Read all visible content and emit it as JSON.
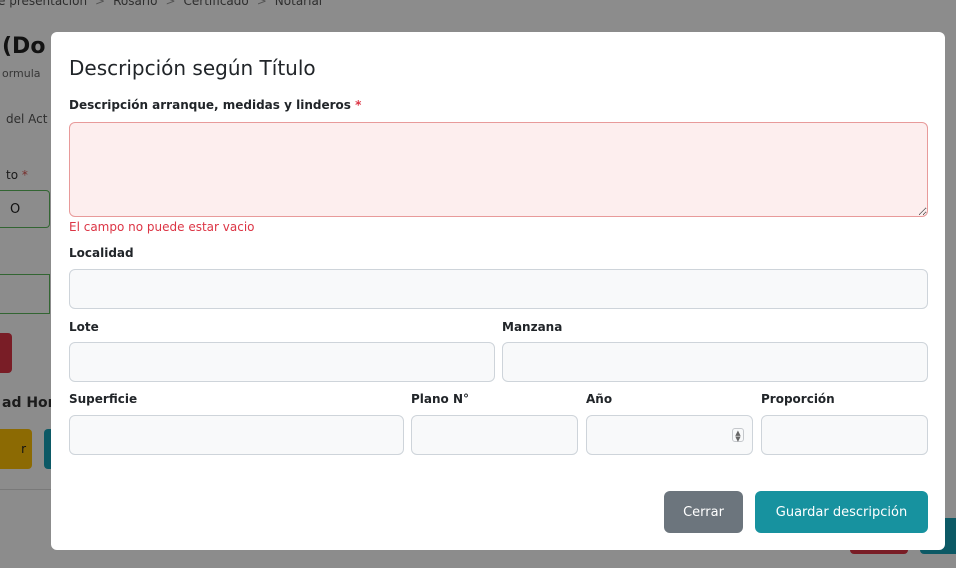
{
  "background": {
    "breadcrumb": [
      "e presentación",
      "Rosario",
      "Certificado",
      "Notarial"
    ],
    "title": "(Do",
    "subtitle": "ormula",
    "tab": "del Act",
    "field_label": "to",
    "field_value": "O",
    "section_heading": "ad Hor",
    "yellow_button": "r"
  },
  "modal": {
    "title": "Descripción según Título",
    "fields": {
      "descripcion": {
        "label": "Descripción arranque, medidas y linderos",
        "required_mark": "*",
        "value": "",
        "error": "El campo no puede estar vacio"
      },
      "localidad": {
        "label": "Localidad",
        "value": ""
      },
      "lote": {
        "label": "Lote",
        "value": ""
      },
      "manzana": {
        "label": "Manzana",
        "value": ""
      },
      "superficie": {
        "label": "Superficie",
        "value": ""
      },
      "plano": {
        "label": "Plano N°",
        "value": ""
      },
      "anio": {
        "label": "Año",
        "value": ""
      },
      "proporcion": {
        "label": "Proporción",
        "value": ""
      }
    },
    "buttons": {
      "close": "Cerrar",
      "save": "Guardar descripción"
    }
  }
}
